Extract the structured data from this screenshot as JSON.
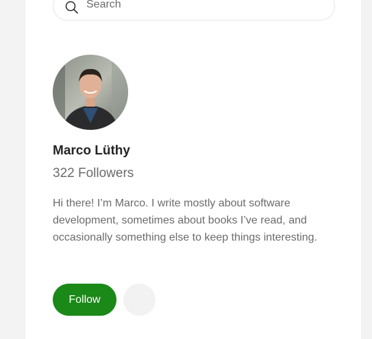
{
  "search": {
    "placeholder": "Search",
    "icon": "search-icon"
  },
  "profile": {
    "name": "Marco Lüthy",
    "followers": "322 Followers",
    "bio": "Hi there! I’m Marco. I write mostly about software development, sometimes about books I’ve read, and occasionally something else to keep things interesting."
  },
  "actions": {
    "follow_label": "Follow",
    "subscribe_icon": "mail-subscribe-icon"
  },
  "colors": {
    "accent": "#1a8917",
    "text_primary": "#242424",
    "text_secondary": "#6b6b6b"
  }
}
